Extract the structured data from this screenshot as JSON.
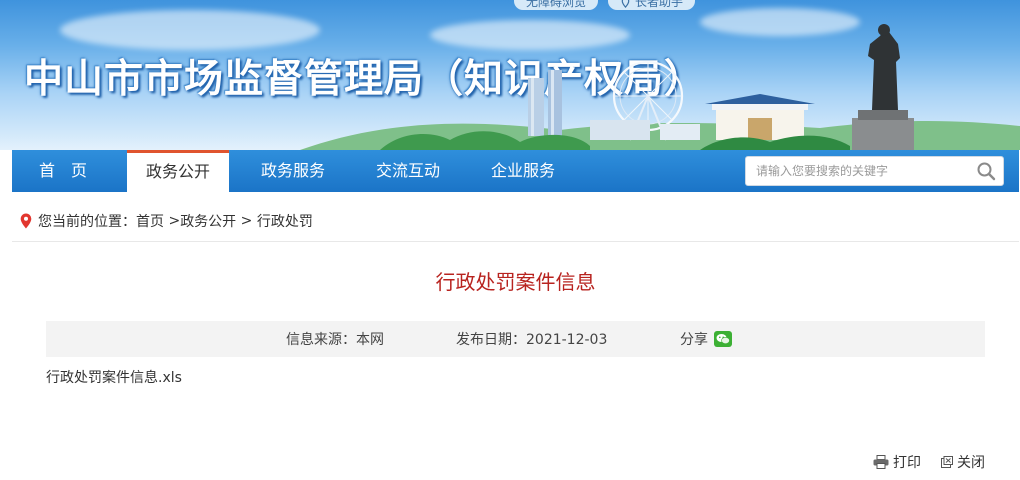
{
  "header": {
    "title": "中山市市场监督管理局（知识产权局）",
    "top_links": [
      "无障碍浏览",
      "长者助手"
    ]
  },
  "nav": {
    "items": [
      {
        "label": "首　页",
        "active": false
      },
      {
        "label": "政务公开",
        "active": true
      },
      {
        "label": "政务服务",
        "active": false
      },
      {
        "label": "交流互动",
        "active": false
      },
      {
        "label": "企业服务",
        "active": false
      }
    ],
    "search_placeholder": "请输入您要搜索的关键字"
  },
  "breadcrumb": {
    "prefix": "您当前的位置：",
    "home": "首页",
    "sep1": " >",
    "section": "政务公开",
    "sep2": " > ",
    "current": "行政处罚"
  },
  "article": {
    "title": "行政处罚案件信息",
    "source": "信息来源：本网",
    "date": "发布日期：2021-12-03",
    "share_label": "分享",
    "attachment": "行政处罚案件信息.xls"
  },
  "actions": {
    "print_label": "打印",
    "close_label": "关闭"
  },
  "colors": {
    "nav_blue": "#1f7fd0",
    "active_tab_border": "#e0542f",
    "title_red": "#b8231f",
    "wechat_green": "#3cb034"
  }
}
